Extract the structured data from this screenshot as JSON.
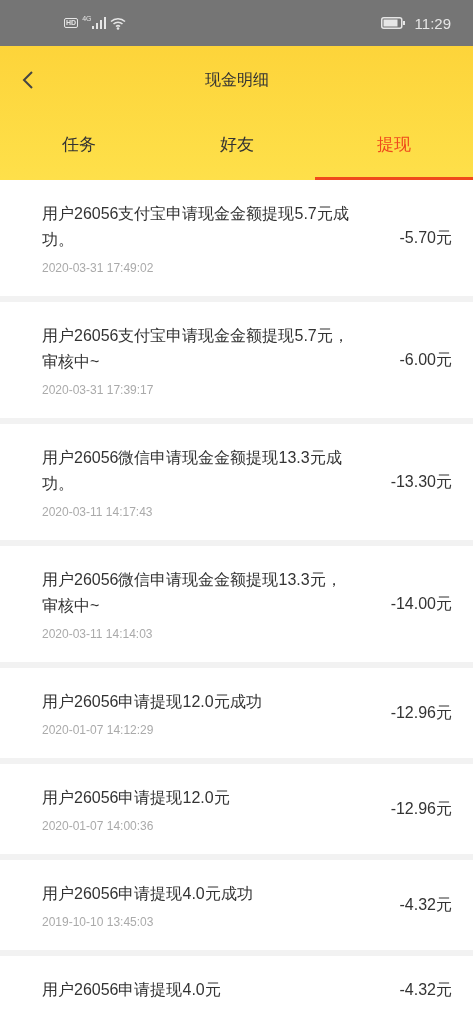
{
  "status_bar": {
    "hd": "HD",
    "network": "4G",
    "time": "11:29"
  },
  "header": {
    "title": "现金明细"
  },
  "tabs": [
    {
      "label": "任务",
      "selected": false
    },
    {
      "label": "好友",
      "selected": false
    },
    {
      "label": "提现",
      "selected": true
    }
  ],
  "records": [
    {
      "description": "用户26056支付宝申请现金金额提现5.7元成功。",
      "time": "2020-03-31 17:49:02",
      "amount": "-5.70元"
    },
    {
      "description": "用户26056支付宝申请现金金额提现5.7元，审核中~",
      "time": "2020-03-31 17:39:17",
      "amount": "-6.00元"
    },
    {
      "description": "用户26056微信申请现金金额提现13.3元成功。",
      "time": "2020-03-11 14:17:43",
      "amount": "-13.30元"
    },
    {
      "description": "用户26056微信申请现金金额提现13.3元，审核中~",
      "time": "2020-03-11 14:14:03",
      "amount": "-14.00元"
    },
    {
      "description": "用户26056申请提现12.0元成功",
      "time": "2020-01-07 14:12:29",
      "amount": "-12.96元"
    },
    {
      "description": "用户26056申请提现12.0元",
      "time": "2020-01-07 14:00:36",
      "amount": "-12.96元"
    },
    {
      "description": "用户26056申请提现4.0元成功",
      "time": "2019-10-10 13:45:03",
      "amount": "-4.32元"
    },
    {
      "description": "用户26056申请提现4.0元",
      "amount": "-4.32元"
    }
  ]
}
